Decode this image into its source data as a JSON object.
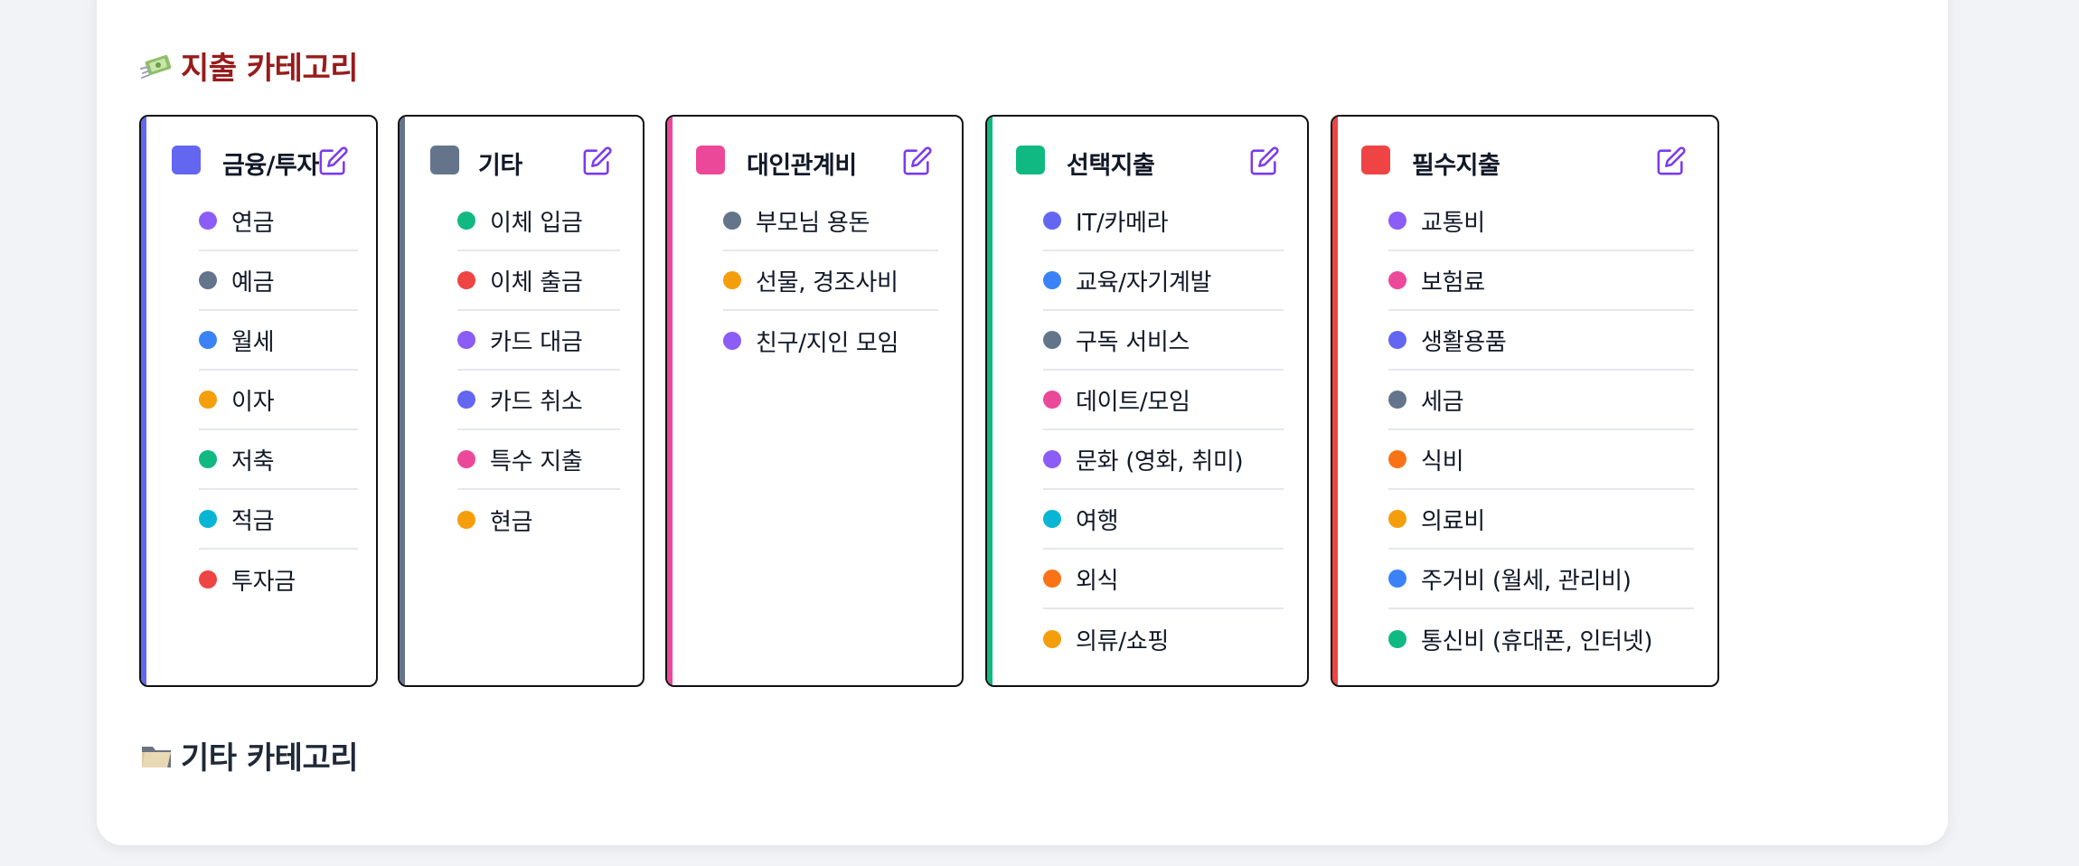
{
  "sections": {
    "expense_title": "지출 카테고리",
    "other_title": "기타 카테고리"
  },
  "cards": [
    {
      "title": "금융/투자",
      "color": "#6366f1",
      "items": [
        {
          "label": "연금",
          "color": "#8b5cf6"
        },
        {
          "label": "예금",
          "color": "#64748b"
        },
        {
          "label": "월세",
          "color": "#3b82f6"
        },
        {
          "label": "이자",
          "color": "#f59e0b"
        },
        {
          "label": "저축",
          "color": "#10b981"
        },
        {
          "label": "적금",
          "color": "#06b6d4"
        },
        {
          "label": "투자금",
          "color": "#ef4444"
        }
      ]
    },
    {
      "title": "기타",
      "color": "#64748b",
      "items": [
        {
          "label": "이체 입금",
          "color": "#10b981"
        },
        {
          "label": "이체 출금",
          "color": "#ef4444"
        },
        {
          "label": "카드 대금",
          "color": "#8b5cf6"
        },
        {
          "label": "카드 취소",
          "color": "#6366f1"
        },
        {
          "label": "특수 지출",
          "color": "#ec4899"
        },
        {
          "label": "현금",
          "color": "#f59e0b"
        }
      ]
    },
    {
      "title": "대인관계비",
      "color": "#ec4899",
      "items": [
        {
          "label": "부모님 용돈",
          "color": "#64748b"
        },
        {
          "label": "선물, 경조사비",
          "color": "#f59e0b"
        },
        {
          "label": "친구/지인 모임",
          "color": "#8b5cf6"
        }
      ]
    },
    {
      "title": "선택지출",
      "color": "#10b981",
      "items": [
        {
          "label": "IT/카메라",
          "color": "#6366f1"
        },
        {
          "label": "교육/자기계발",
          "color": "#3b82f6"
        },
        {
          "label": "구독 서비스",
          "color": "#64748b"
        },
        {
          "label": "데이트/모임",
          "color": "#ec4899"
        },
        {
          "label": "문화 (영화, 취미)",
          "color": "#8b5cf6"
        },
        {
          "label": "여행",
          "color": "#06b6d4"
        },
        {
          "label": "외식",
          "color": "#f97316"
        },
        {
          "label": "의류/쇼핑",
          "color": "#f59e0b"
        }
      ]
    },
    {
      "title": "필수지출",
      "color": "#ef4444",
      "items": [
        {
          "label": "교통비",
          "color": "#8b5cf6"
        },
        {
          "label": "보험료",
          "color": "#ec4899"
        },
        {
          "label": "생활용품",
          "color": "#6366f1"
        },
        {
          "label": "세금",
          "color": "#64748b"
        },
        {
          "label": "식비",
          "color": "#f97316"
        },
        {
          "label": "의료비",
          "color": "#f59e0b"
        },
        {
          "label": "주거비 (월세, 관리비)",
          "color": "#3b82f6"
        },
        {
          "label": "통신비 (휴대폰, 인터넷)",
          "color": "#10b981"
        }
      ]
    }
  ],
  "icons": {
    "edit": "pencil-square-icon",
    "expense_section": "money-flying-icon",
    "other_section": "folder-icon",
    "edit_color": "#7c3aed"
  }
}
